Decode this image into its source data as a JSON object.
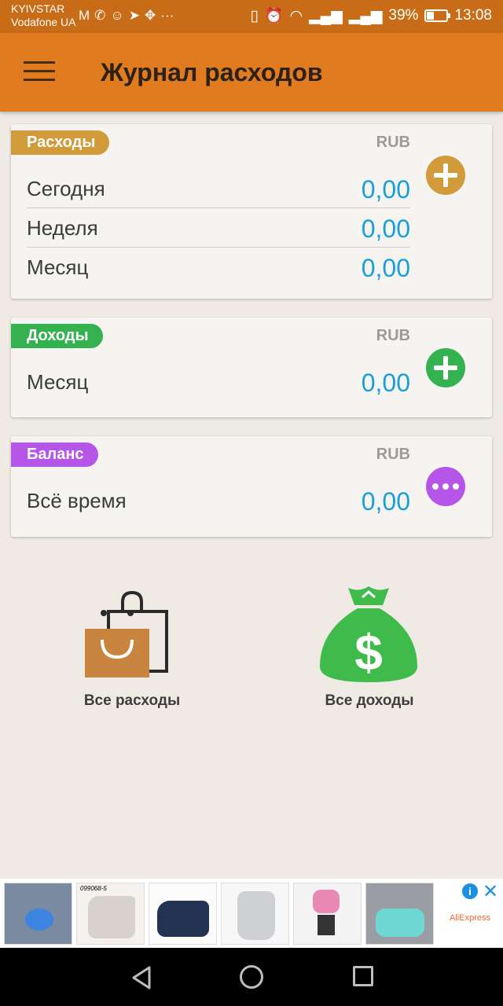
{
  "status_bar": {
    "carrier1": "KYIVSTAR",
    "carrier2": "Vodafone UA",
    "left_icons": [
      "gmail-icon",
      "viber-icon",
      "messenger-icon",
      "telegram-icon",
      "move-icon",
      "more-icon"
    ],
    "battery": "39%",
    "battery_level": 0.39,
    "time": "13:08"
  },
  "app_bar": {
    "title": "Журнал расходов"
  },
  "expenses": {
    "tag": "Расходы",
    "currency": "RUB",
    "rows": [
      {
        "label": "Сегодня",
        "value": "0,00"
      },
      {
        "label": "Неделя",
        "value": "0,00"
      },
      {
        "label": "Месяц",
        "value": "0,00"
      }
    ]
  },
  "income": {
    "tag": "Доходы",
    "currency": "RUB",
    "rows": [
      {
        "label": "Месяц",
        "value": "0,00"
      }
    ]
  },
  "balance": {
    "tag": "Баланс",
    "currency": "RUB",
    "rows": [
      {
        "label": "Всё время",
        "value": "0,00"
      }
    ]
  },
  "links": {
    "all_expenses": "Все расходы",
    "all_income": "Все доходы"
  },
  "ad": {
    "brand": "AliExpress",
    "info": "i",
    "close": "✕",
    "banner_text": "099068-5"
  },
  "colors": {
    "status_bar": "#c86c17",
    "app_bar": "#e07b1f",
    "expenses_accent": "#d19a3a",
    "income_accent": "#34b24f",
    "balance_accent": "#b656e8",
    "value_text": "#1a9fd6",
    "background": "#efebe4"
  }
}
